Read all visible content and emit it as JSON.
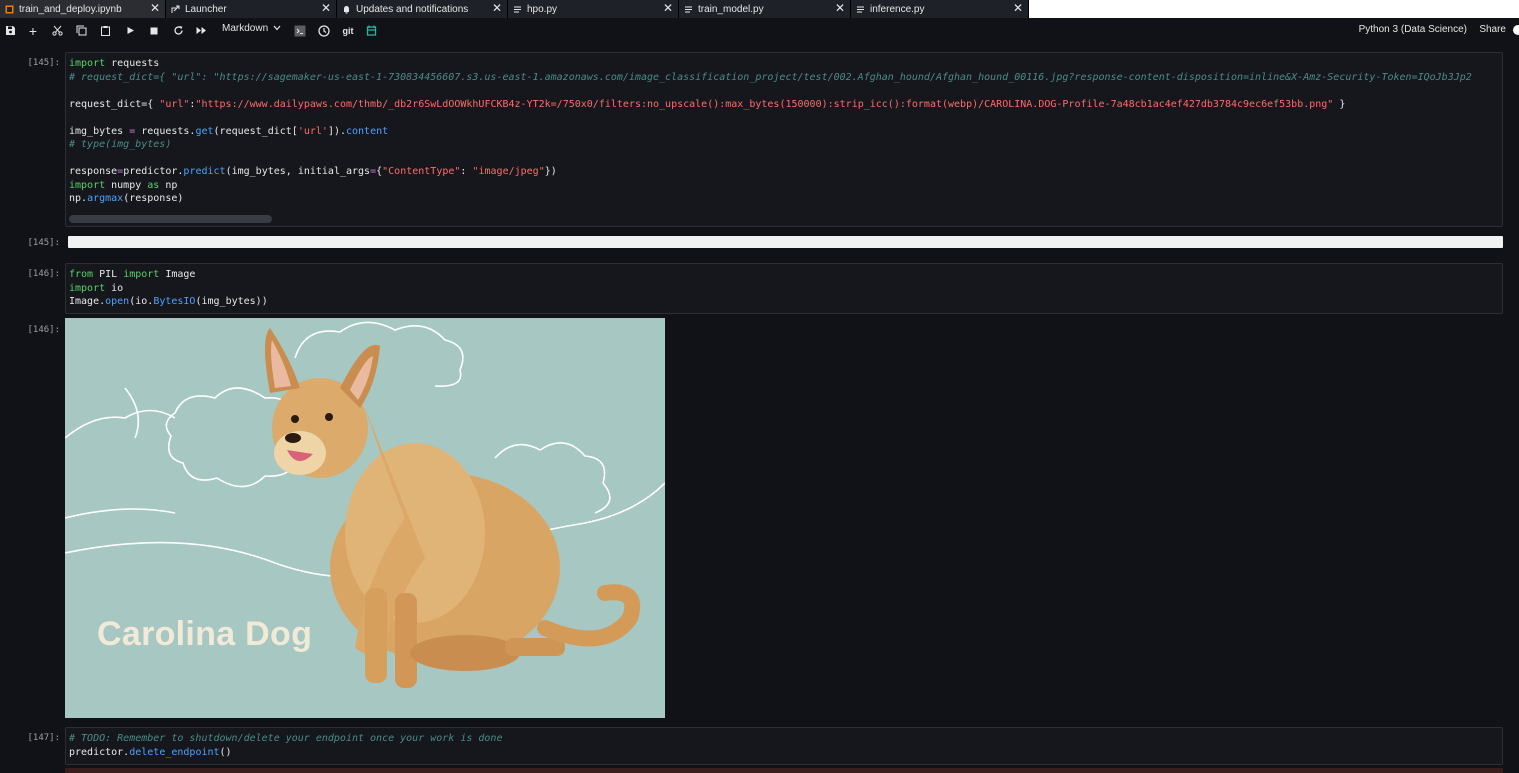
{
  "tabs": [
    {
      "label": "train_and_deploy.ipynb",
      "icon": "notebook-icon",
      "active": true
    },
    {
      "label": "Launcher",
      "icon": "launcher-icon",
      "active": false
    },
    {
      "label": "Updates and notifications",
      "icon": "bell-icon",
      "active": false
    },
    {
      "label": "hpo.py",
      "icon": "file-icon",
      "active": false
    },
    {
      "label": "train_model.py",
      "icon": "file-icon",
      "active": false
    },
    {
      "label": "inference.py",
      "icon": "file-icon",
      "active": false
    }
  ],
  "toolbar": {
    "cell_type": "Markdown",
    "kernel": "Python 3 (Data Science)",
    "share": "Share",
    "git": "git"
  },
  "cells": {
    "c1_in_prompt": "[145]:",
    "c1_out_prompt": "[145]:",
    "c2_in_prompt": "[146]:",
    "c2_out_prompt": "[146]:",
    "c3_in_prompt": "[147]:"
  },
  "image": {
    "caption": "Carolina Dog"
  }
}
